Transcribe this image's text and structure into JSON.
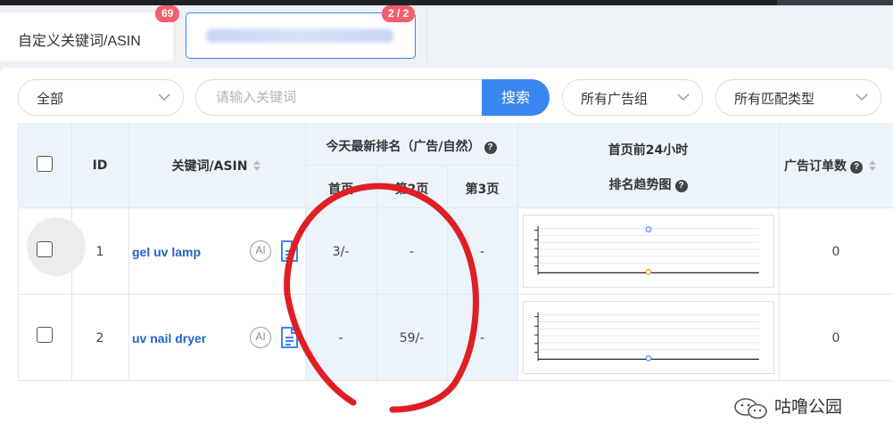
{
  "tabs": [
    {
      "label": "自定义关键词/ASIN",
      "badge": "69"
    },
    {
      "label": "",
      "badge": "2 / 2"
    }
  ],
  "filters": {
    "scope_select": "全部",
    "search_placeholder": "请输入关键词",
    "search_button": "搜索",
    "adgroup_select": "所有广告组",
    "match_select": "所有匹配类型"
  },
  "table": {
    "headers": {
      "id": "ID",
      "keyword": "关键词/ASIN",
      "rank_group": "今天最新排名（广告/自然）",
      "rank_page1": "首页",
      "rank_page2": "第2页",
      "rank_page3": "第3页",
      "trend_line1": "首页前24小时",
      "trend_line2": "排名趋势图",
      "ad_orders": "广告订单数"
    },
    "rows": [
      {
        "id": "1",
        "keyword": "gel uv lamp",
        "page1": "3/-",
        "page2": "-",
        "page3": "-",
        "orders": "0",
        "ai_label": "AI"
      },
      {
        "id": "2",
        "keyword": "uv nail dryer",
        "page1": "-",
        "page2": "59/-",
        "page3": "-",
        "orders": "0",
        "ai_label": "AI"
      }
    ]
  },
  "watermark": "咕噜公园",
  "colors": {
    "accent": "#3a86f0",
    "badge": "#f0616d",
    "link": "#2264c8",
    "header_bg": "#edf3fb",
    "annotation": "#e01e25"
  }
}
